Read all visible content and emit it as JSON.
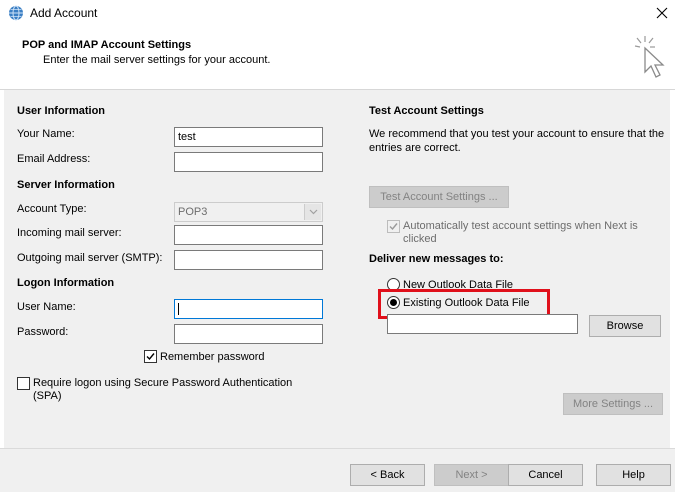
{
  "window": {
    "title": "Add Account",
    "icon": "outlook-globe-icon",
    "close_icon": "close-icon"
  },
  "header": {
    "title": "POP and IMAP Account Settings",
    "subtitle": "Enter the mail server settings for your account.",
    "icon": "wizard-cursor-icon"
  },
  "user_info": {
    "section_label": "User Information",
    "your_name_label": "Your Name:",
    "your_name_value": "test",
    "email_label": "Email Address:",
    "email_value": ""
  },
  "server_info": {
    "section_label": "Server Information",
    "account_type_label": "Account Type:",
    "account_type_value": "POP3",
    "incoming_label": "Incoming mail server:",
    "incoming_value": "",
    "outgoing_label": "Outgoing mail server (SMTP):",
    "outgoing_value": ""
  },
  "logon_info": {
    "section_label": "Logon Information",
    "username_label": "User Name:",
    "username_value": "",
    "password_label": "Password:",
    "password_value": "",
    "remember_label": "Remember password",
    "remember_checked": true,
    "spa_label": "Require logon using Secure Password Authentication (SPA)",
    "spa_checked": false
  },
  "test_settings": {
    "section_label": "Test Account Settings",
    "description": "We recommend that you test your account to ensure that the entries are correct.",
    "test_button": "Test Account Settings ...",
    "auto_test_label": "Automatically test account settings when Next is clicked",
    "auto_test_checked": true
  },
  "deliver": {
    "section_label": "Deliver new messages to:",
    "new_file_label": "New Outlook Data File",
    "existing_file_label": "Existing Outlook Data File",
    "selected": "existing",
    "path_value": "",
    "browse_button": "Browse"
  },
  "more_settings_button": "More Settings ...",
  "footer": {
    "back": "< Back",
    "next": "Next >",
    "cancel": "Cancel",
    "help": "Help"
  },
  "colors": {
    "highlight": "#e0101b",
    "panel": "#f0f0f0",
    "focus": "#0078d7"
  }
}
